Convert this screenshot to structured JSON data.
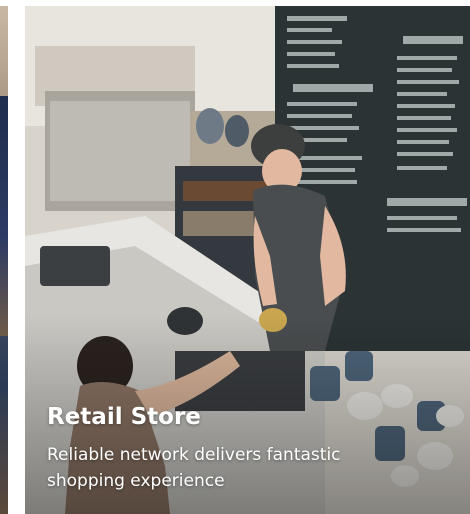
{
  "slide": {
    "title": "Retail Store",
    "description": "Reliable network delivers fantastic shopping experience"
  }
}
